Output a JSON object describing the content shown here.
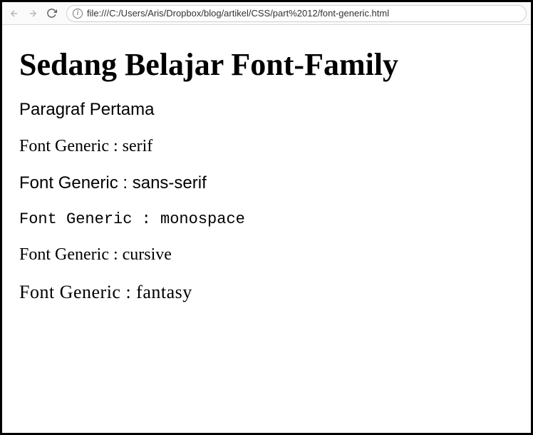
{
  "toolbar": {
    "url": "file:///C:/Users/Aris/Dropbox/blog/artikel/CSS/part%2012/font-generic.html"
  },
  "content": {
    "heading": "Sedang Belajar Font-Family",
    "p_default": "Paragraf Pertama",
    "p_serif": "Font Generic : serif",
    "p_sans": "Font Generic : sans-serif",
    "p_mono": "Font Generic : monospace",
    "p_cursive": "Font Generic : cursive",
    "p_fantasy": "Font Generic : fantasy"
  }
}
